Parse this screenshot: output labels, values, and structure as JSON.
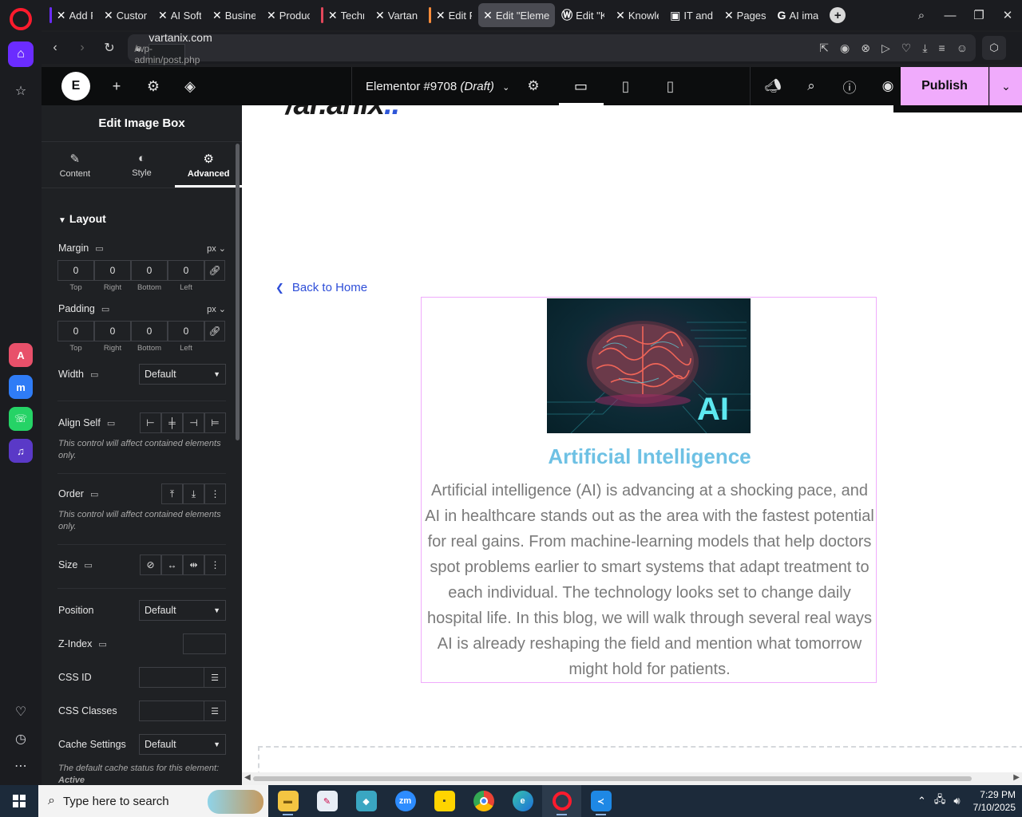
{
  "browser": {
    "tabs": [
      {
        "label": "Add Po",
        "icon": "elementor-x",
        "group_color": "#6b2cff"
      },
      {
        "label": "Custom",
        "icon": "elementor-x",
        "group_color": ""
      },
      {
        "label": "AI Soft",
        "icon": "elementor-x",
        "group_color": ""
      },
      {
        "label": "Busine",
        "icon": "elementor-x",
        "group_color": ""
      },
      {
        "label": "Produc",
        "icon": "elementor-x",
        "group_color": ""
      },
      {
        "label": "Techno",
        "icon": "elementor-x",
        "group_color": "#e2475b"
      },
      {
        "label": "Vartan",
        "icon": "elementor-x",
        "group_color": ""
      },
      {
        "label": "Edit Po",
        "icon": "elementor-x",
        "group_color": "#ff8c3a"
      },
      {
        "label": "Edit \"Elemen",
        "icon": "elementor-x",
        "group_color": "",
        "active": true
      },
      {
        "label": "Edit \"K",
        "icon": "wordpress",
        "group_color": ""
      },
      {
        "label": "Knowle",
        "icon": "elementor-x",
        "group_color": ""
      },
      {
        "label": "IT and",
        "icon": "site-favicon",
        "group_color": ""
      },
      {
        "label": "Pages",
        "icon": "elementor-x",
        "group_color": ""
      },
      {
        "label": "AI ima",
        "icon": "google",
        "group_color": ""
      }
    ],
    "url_host": "vartanix.com",
    "url_path": "/wp-admin/post.php"
  },
  "elementor": {
    "document_title": "Elementor #9708",
    "document_status": "(Draft)",
    "publish_label": "Publish",
    "panel": {
      "header": "Edit Image Box",
      "tabs": [
        {
          "label": "Content",
          "icon": "pencil-icon"
        },
        {
          "label": "Style",
          "icon": "contrast-icon"
        },
        {
          "label": "Advanced",
          "icon": "gear-icon",
          "active": true
        }
      ],
      "section_title": "Layout",
      "margin": {
        "label": "Margin",
        "unit": "px",
        "values": [
          "0",
          "0",
          "0",
          "0"
        ]
      },
      "padding": {
        "label": "Padding",
        "unit": "px",
        "values": [
          "0",
          "0",
          "0",
          "0"
        ]
      },
      "dim_labels": [
        "Top",
        "Right",
        "Bottom",
        "Left"
      ],
      "width": {
        "label": "Width",
        "value": "Default"
      },
      "align_self": {
        "label": "Align Self",
        "note": "This control will affect contained elements only."
      },
      "order": {
        "label": "Order",
        "note": "This control will affect contained elements only."
      },
      "size": {
        "label": "Size"
      },
      "position": {
        "label": "Position",
        "value": "Default"
      },
      "z_index": {
        "label": "Z-Index"
      },
      "css_id": {
        "label": "CSS ID"
      },
      "css_classes": {
        "label": "CSS Classes"
      },
      "cache_settings": {
        "label": "Cache Settings",
        "value": "Default"
      },
      "cache_note": "The default cache status for this element:",
      "cache_note_status": "Active"
    }
  },
  "canvas": {
    "back_link": "Back to Home",
    "image_box": {
      "image_text": "AI",
      "title": "Artificial Intelligence",
      "description": "Artificial intelligence (AI) is advancing at a shocking pace, and AI in healthcare stands out as the area with the fastest potential for real gains. From machine-learning models that help doctors spot problems earlier to smart systems that adapt treatment to each individual. The technology looks set to change daily hospital life. In this blog, we will walk through several real ways AI is already reshaping the field and mention what tomorrow might hold for patients."
    }
  },
  "taskbar": {
    "search_placeholder": "Type here to search",
    "apps": [
      "file-explorer",
      "paint-app",
      "tool-app",
      "zoom",
      "sticky-notes",
      "chrome",
      "edge",
      "opera",
      "vscode"
    ],
    "time": "7:29 PM",
    "date": "7/10/2025"
  },
  "colors": {
    "publish": "#f0abfc",
    "title_blue": "#6ec1e4",
    "link_blue": "#2e4ed8",
    "opera_red": "#ff1b2d"
  }
}
